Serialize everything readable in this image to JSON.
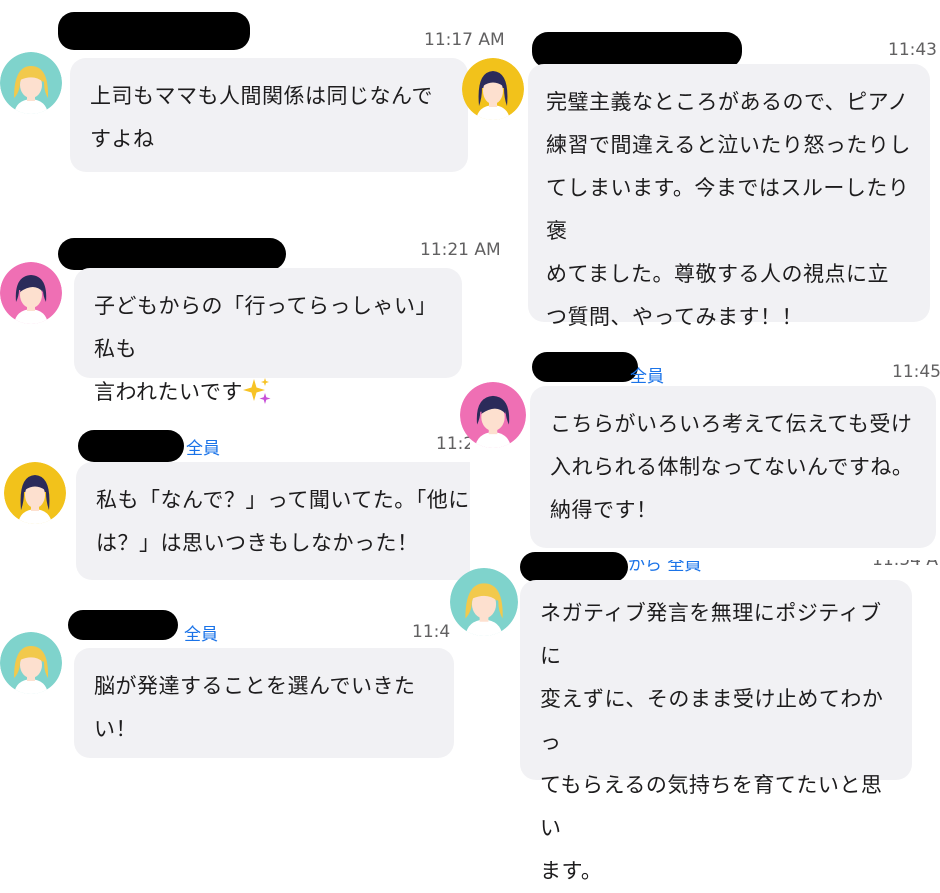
{
  "messages": {
    "m1": {
      "time": "11:17 AM",
      "text": "上司もママも人間関係は同じなんで\nすよね"
    },
    "m2": {
      "time": "11:21 AM",
      "text": "子どもからの「行ってらっしゃい」私も\n言われたいです"
    },
    "m3": {
      "to": "全員",
      "time": "11:2",
      "text": "私も「なんで？」って聞いてた。「他に\nは？」は思いつきもしなかった！"
    },
    "m4": {
      "to": "全員",
      "time": "11:4",
      "text": "脳が発達することを選んでいきた\nい！"
    },
    "m5": {
      "time": "11:43",
      "text": "完璧主義なところがあるので、ピアノ\n練習で間違えると泣いたり怒ったりし\nてしまいます。今まではスルーしたり褒\nめてました。尊敬する人の視点に立\nつ質問、やってみます！！"
    },
    "m6": {
      "to": "全員",
      "time": "11:45",
      "text": "こちらがいろいろ考えて伝えても受け\n入れられる体制なってないんですね。\n納得です！"
    },
    "m7": {
      "to": "から 全員",
      "time": "11:54 A",
      "text": "ネガティブ発言を無理にポジティブに\n変えずに、そのまま受け止めてわかっ\nてもらえるの気持ちを育てたいと思い\nます。"
    }
  },
  "emoji": "sparkles-emoji",
  "avatar_colors": {
    "teal": "#7fd3cc",
    "pink": "#ef6fb4",
    "yellow": "#f2c21b"
  }
}
